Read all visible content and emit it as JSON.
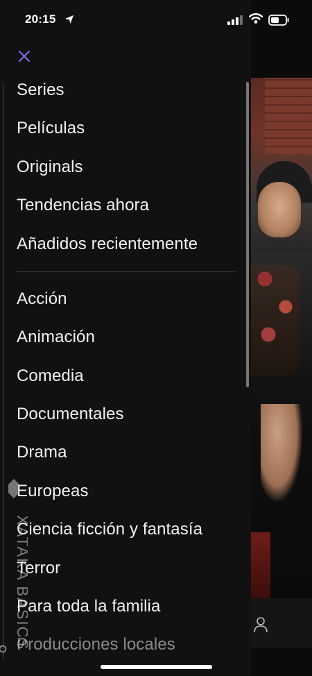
{
  "status_bar": {
    "time": "20:15"
  },
  "menu": {
    "close_icon": "close-icon",
    "primary": [
      "Series",
      "Películas",
      "Originals",
      "Tendencias ahora",
      "Añadidos recientemente"
    ],
    "genres": [
      "Acción",
      "Animación",
      "Comedia",
      "Documentales",
      "Drama",
      "Europeas",
      "Ciencia ficción y fantasía",
      "Terror",
      "Para toda la familia",
      "Producciones locales"
    ]
  },
  "watermark": {
    "text": "XATAKA BASICS"
  },
  "colors": {
    "accent": "#8a6cf2",
    "drawer_bg": "#111111",
    "text": "#f2f2f2"
  }
}
